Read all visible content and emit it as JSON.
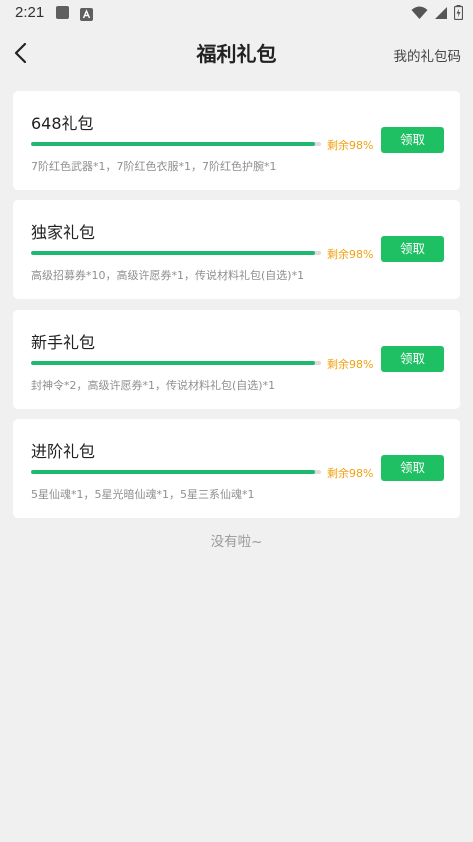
{
  "status_bar": {
    "time": "2:21",
    "icons": [
      "app-notification-icon",
      "a-notification-icon",
      "wifi-icon",
      "signal-icon",
      "battery-icon"
    ]
  },
  "header": {
    "back_icon": "back-arrow-icon",
    "title": "福利礼包",
    "my_codes": "我的礼包码"
  },
  "packages": [
    {
      "name": "648礼包",
      "remaining_label": "剩余98%",
      "remaining_fraction": 0.98,
      "contents": "7阶红色武器*1，7阶红色衣服*1，7阶红色护腕*1",
      "button_label": "领取"
    },
    {
      "name": "独家礼包",
      "remaining_label": "剩余98%",
      "remaining_fraction": 0.98,
      "contents": "高级招募券*10，高级许愿券*1，传说材料礼包(自选)*1",
      "button_label": "领取"
    },
    {
      "name": "新手礼包",
      "remaining_label": "剩余98%",
      "remaining_fraction": 0.98,
      "contents": "封神令*2，高级许愿券*1，传说材料礼包(自选)*1",
      "button_label": "领取"
    },
    {
      "name": "进阶礼包",
      "remaining_label": "剩余98%",
      "remaining_fraction": 0.98,
      "contents": "5星仙魂*1，5星光暗仙魂*1，5星三系仙魂*1",
      "button_label": "领取"
    }
  ],
  "end_text": "没有啦~",
  "colors": {
    "accent": "#1fc063",
    "progress": "#1fb871",
    "remaining_text": "#f0a112",
    "background": "#f0f0f0",
    "card": "#ffffff"
  }
}
